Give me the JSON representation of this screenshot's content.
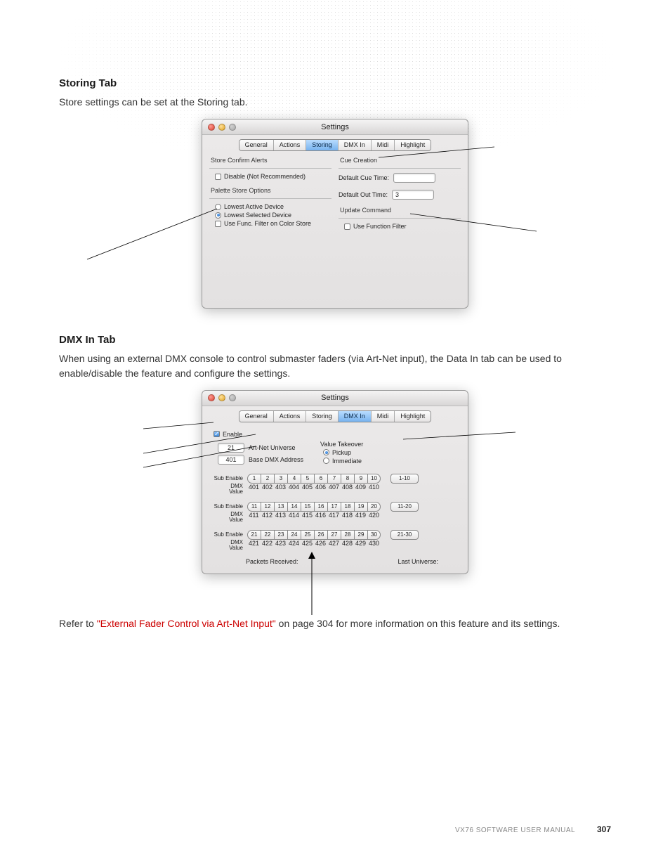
{
  "sections": {
    "storing": {
      "heading": "Storing Tab",
      "intro": "Store settings can be set at the Storing tab."
    },
    "dmx": {
      "heading": "DMX In Tab",
      "intro": "When using an external DMX console to control submaster faders (via Art-Net input), the Data In tab can be used to enable/disable the feature and configure the settings."
    },
    "refer": {
      "prefix": "Refer to ",
      "link": "\"External Fader Control via Art-Net Input\"",
      "suffix": " on page 304 for more information on this feature and its settings."
    }
  },
  "window_title": "Settings",
  "tabs": [
    "General",
    "Actions",
    "Storing",
    "DMX In",
    "Midi",
    "Highlight"
  ],
  "storing_win": {
    "store_confirm_label": "Store Confirm Alerts",
    "disable_label": "Disable (Not Recommended)",
    "palette_label": "Palette Store Options",
    "lowest_active": "Lowest Active Device",
    "lowest_selected": "Lowest Selected Device",
    "use_func_color": "Use Func. Filter on Color Store",
    "cue_creation": "Cue Creation",
    "default_cue_time": "Default Cue Time:",
    "default_out_time": "Default Out Time:",
    "default_out_value": "3",
    "update_command": "Update Command",
    "use_function_filter": "Use Function Filter"
  },
  "dmx_win": {
    "enable": "Enable",
    "artnet_value": "21",
    "artnet_label": "Art-Net Universe",
    "basedmx_value": "401",
    "basedmx_label": "Base DMX Address",
    "vt_label": "Value Takeover",
    "pickup": "Pickup",
    "immediate": "Immediate",
    "sub_enable": "Sub Enable",
    "dmx_value": "DMX\nValue",
    "rows": [
      {
        "nums": [
          "1",
          "2",
          "3",
          "4",
          "5",
          "6",
          "7",
          "8",
          "9",
          "10"
        ],
        "range": "1-10",
        "vals": [
          "401",
          "402",
          "403",
          "404",
          "405",
          "406",
          "407",
          "408",
          "409",
          "410"
        ]
      },
      {
        "nums": [
          "11",
          "12",
          "13",
          "14",
          "15",
          "16",
          "17",
          "18",
          "19",
          "20"
        ],
        "range": "11-20",
        "vals": [
          "411",
          "412",
          "413",
          "414",
          "415",
          "416",
          "417",
          "418",
          "419",
          "420"
        ]
      },
      {
        "nums": [
          "21",
          "22",
          "23",
          "24",
          "25",
          "26",
          "27",
          "28",
          "29",
          "30"
        ],
        "range": "21-30",
        "vals": [
          "421",
          "422",
          "423",
          "424",
          "425",
          "426",
          "427",
          "428",
          "429",
          "430"
        ]
      }
    ],
    "packets": "Packets Received:",
    "last_universe": "Last Universe:"
  },
  "footer": {
    "manual": "VX76 SOFTWARE USER MANUAL",
    "page": "307"
  }
}
